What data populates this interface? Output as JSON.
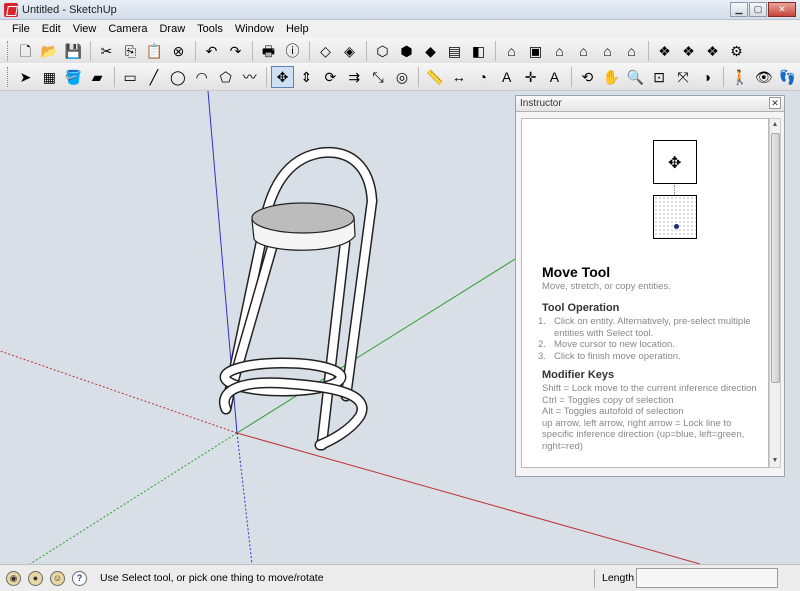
{
  "window": {
    "title": "Untitled - SketchUp"
  },
  "menu": [
    "File",
    "Edit",
    "View",
    "Camera",
    "Draw",
    "Tools",
    "Window",
    "Help"
  ],
  "toolbar_row1": [
    [
      "new-icon",
      "🗋"
    ],
    [
      "open-icon",
      "📂"
    ],
    [
      "save-icon",
      "💾"
    ],
    null,
    [
      "cut-icon",
      "✂"
    ],
    [
      "copy-icon",
      "⎘"
    ],
    [
      "paste-icon",
      "📋"
    ],
    [
      "erase-icon",
      "⊗"
    ],
    null,
    [
      "undo-icon",
      "↶"
    ],
    [
      "redo-icon",
      "↷"
    ],
    null,
    [
      "print-icon",
      "🖶"
    ],
    [
      "model-info-icon",
      "ⓘ"
    ],
    null,
    [
      "xray-icon",
      "◇"
    ],
    [
      "back-edges-icon",
      "◈"
    ],
    null,
    [
      "wireframe-icon",
      "⬡"
    ],
    [
      "hidden-line-icon",
      "⬢"
    ],
    [
      "shaded-icon",
      "◆"
    ],
    [
      "shaded-textures-icon",
      "▤"
    ],
    [
      "monochrome-icon",
      "◧"
    ],
    null,
    [
      "iso-view-icon",
      "⌂"
    ],
    [
      "top-view-icon",
      "▣"
    ],
    [
      "front-view-icon",
      "⌂"
    ],
    [
      "right-view-icon",
      "⌂"
    ],
    [
      "back-view-icon",
      "⌂"
    ],
    [
      "left-view-icon",
      "⌂"
    ],
    null,
    [
      "get-models-icon",
      "❖"
    ],
    [
      "share-model-icon",
      "❖"
    ],
    [
      "share-component-icon",
      "❖"
    ],
    [
      "extension-warehouse-icon",
      "⚙"
    ]
  ],
  "toolbar_row2": [
    [
      "select-icon",
      "➤"
    ],
    [
      "make-component-icon",
      "▦"
    ],
    [
      "paint-bucket-icon",
      "🪣"
    ],
    [
      "eraser-icon",
      "▰"
    ],
    null,
    [
      "rectangle-icon",
      "▭"
    ],
    [
      "line-icon",
      "╱"
    ],
    [
      "circle-icon",
      "◯"
    ],
    [
      "arc-icon",
      "◠"
    ],
    [
      "polygon-icon",
      "⬠"
    ],
    [
      "freehand-icon",
      "〰"
    ],
    null,
    [
      "move-icon",
      "✥"
    ],
    [
      "push-pull-icon",
      "⇕"
    ],
    [
      "rotate-icon",
      "⟳"
    ],
    [
      "follow-me-icon",
      "⇉"
    ],
    [
      "scale-icon",
      "⤡"
    ],
    [
      "offset-icon",
      "◎"
    ],
    null,
    [
      "tape-measure-icon",
      "📏"
    ],
    [
      "dimension-icon",
      "↔"
    ],
    [
      "protractor-icon",
      "◔"
    ],
    [
      "text-icon",
      "A"
    ],
    [
      "axes-icon",
      "✛"
    ],
    [
      "3d-text-icon",
      "A"
    ],
    null,
    [
      "orbit-icon",
      "⟲"
    ],
    [
      "pan-icon",
      "✋"
    ],
    [
      "zoom-icon",
      "🔍"
    ],
    [
      "zoom-window-icon",
      "⊡"
    ],
    [
      "zoom-extents-icon",
      "⤧"
    ],
    [
      "previous-view-icon",
      "◑"
    ],
    null,
    [
      "position-camera-icon",
      "🚶"
    ],
    [
      "look-around-icon",
      "👁"
    ],
    [
      "walk-icon",
      "👣"
    ]
  ],
  "instructor": {
    "header": "Instructor",
    "title": "Move Tool",
    "subtitle": "Move, stretch, or copy entities.",
    "operation_heading": "Tool Operation",
    "operation_steps": [
      "Click on entity. Alternatively, pre-select multiple entities with Select tool.",
      "Move cursor to new location.",
      "Click to finish move operation."
    ],
    "modifier_heading": "Modifier Keys",
    "modifiers": [
      "Shift = Lock move to the current inference direction",
      "Ctrl = Toggles copy of selection",
      "Alt = Toggles autofold of selection",
      "up arrow, left arrow, right arrow = Lock line to specific inference direction (up=blue, left=green, right=red)"
    ]
  },
  "status": {
    "message": "Use Select tool, or pick one thing to move/rotate",
    "measure_label": "Length",
    "measure_value": ""
  }
}
